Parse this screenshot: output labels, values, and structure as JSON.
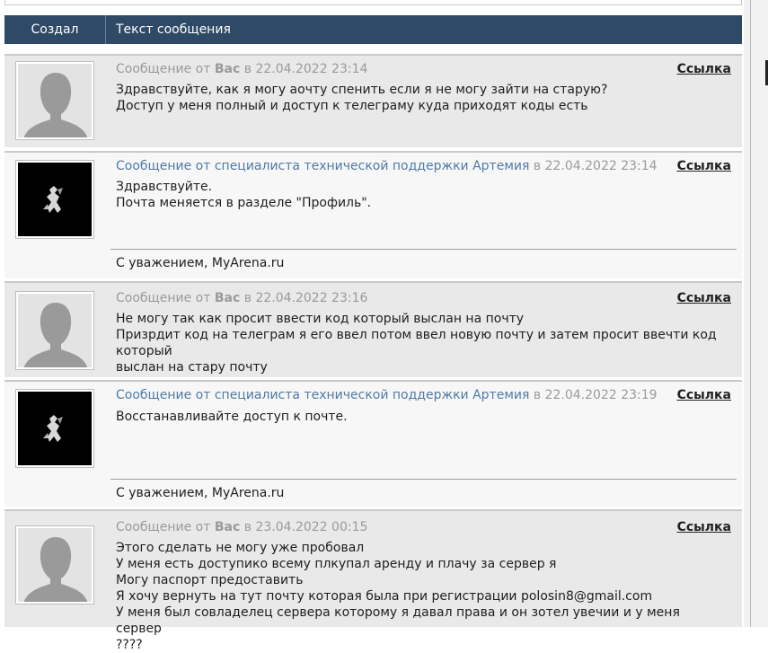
{
  "header": {
    "author_col": "Создал",
    "text_col": "Текст сообщения"
  },
  "messages": [
    {
      "type": "user",
      "prefix": "Сообщение от",
      "author": "Вас",
      "at": "в",
      "date": "22.04.2022 23:14",
      "link": "Ссылка",
      "lines": [
        "Здравствуйте, как я могу аочту спенить если я не могу зайти на старую?",
        "Доступ у меня полный и доступ к телеграму куда приходят коды есть"
      ]
    },
    {
      "type": "support",
      "prefix": "Сообщение от",
      "author": "специалиста технической поддержки Артемия",
      "at": "в",
      "date": "22.04.2022 23:14",
      "link": "Ссылка",
      "lines": [
        "Здравствуйте.",
        "Почта меняется в разделе \"Профиль\"."
      ],
      "signature": "С уважением, MyArena.ru"
    },
    {
      "type": "user",
      "prefix": "Сообщение от",
      "author": "Вас",
      "at": "в",
      "date": "22.04.2022 23:16",
      "link": "Ссылка",
      "lines": [
        "Не могу так как просит ввести код который выслан на почту",
        "Призрдит код на телеграм я его ввел потом ввел новую почту и затем просит ввечти код который",
        "выслан на стару почту"
      ]
    },
    {
      "type": "support",
      "prefix": "Сообщение от",
      "author": "специалиста технической поддержки Артемия",
      "at": "в",
      "date": "22.04.2022 23:19",
      "link": "Ссылка",
      "lines": [
        "Восстанавливайте доступ к почте."
      ],
      "signature": "С уважением, MyArena.ru"
    },
    {
      "type": "user",
      "prefix": "Сообщение от",
      "author": "Вас",
      "at": "в",
      "date": "23.04.2022 00:15",
      "link": "Ссылка",
      "lines": [
        "Этого сделать не могу уже пробовал",
        "У меня есть доступико всему плкупал аренду и плачу за сервер я",
        "Могу паспорт предоставить",
        "Я хочу вернуть на тут почту которая была при регистрации polosin8@gmail.com",
        "У меня был совладелец сервера которому я давал права и он зотел увечии и у меня сервер",
        "????"
      ]
    }
  ],
  "colors": {
    "header_bg": "#2e4a66",
    "support_name": "#4f7ba5",
    "user_row_bg": "#e9e9e9",
    "support_row_bg": "#f7f7f7"
  }
}
